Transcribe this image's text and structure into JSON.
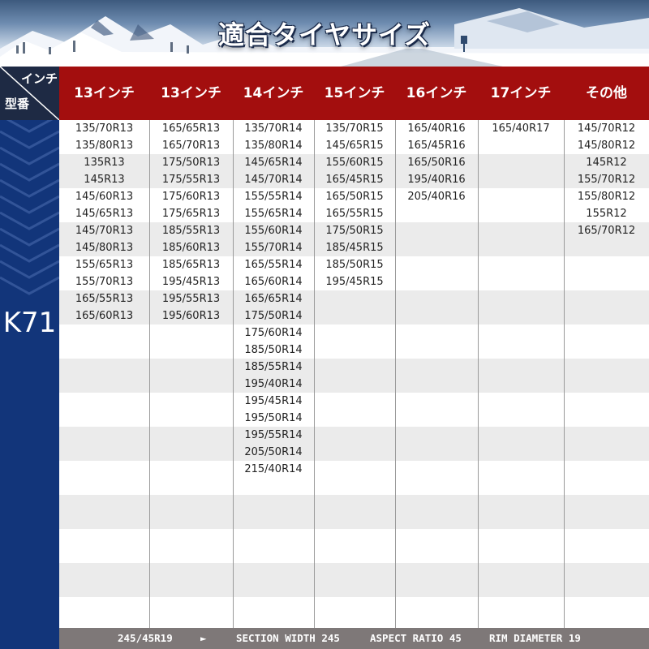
{
  "banner": {
    "title": "適合タイヤサイズ"
  },
  "corner": {
    "top_label": "インチ",
    "bottom_label": "型番"
  },
  "model": {
    "label": "K71"
  },
  "columns": [
    {
      "header": "13インチ",
      "sizes": [
        "135/70R13",
        "135/80R13",
        "135R13",
        "145R13",
        "145/60R13",
        "145/65R13",
        "145/70R13",
        "145/80R13",
        "155/65R13",
        "155/70R13",
        "165/55R13",
        "165/60R13"
      ]
    },
    {
      "header": "13インチ",
      "sizes": [
        "165/65R13",
        "165/70R13",
        "175/50R13",
        "175/55R13",
        "175/60R13",
        "175/65R13",
        "185/55R13",
        "185/60R13",
        "185/65R13",
        "195/45R13",
        "195/55R13",
        "195/60R13"
      ]
    },
    {
      "header": "14インチ",
      "sizes": [
        "135/70R14",
        "135/80R14",
        "145/65R14",
        "145/70R14",
        "155/55R14",
        "155/65R14",
        "155/60R14",
        "155/70R14",
        "165/55R14",
        "165/60R14",
        "165/65R14",
        "175/50R14",
        "175/60R14",
        "185/50R14",
        "185/55R14",
        "195/40R14",
        "195/45R14",
        "195/50R14",
        "195/55R14",
        "205/50R14",
        "215/40R14"
      ]
    },
    {
      "header": "15インチ",
      "sizes": [
        "135/70R15",
        "145/65R15",
        "155/60R15",
        "165/45R15",
        "165/50R15",
        "165/55R15",
        "175/50R15",
        "185/45R15",
        "185/50R15",
        "195/45R15"
      ]
    },
    {
      "header": "16インチ",
      "sizes": [
        "165/40R16",
        "165/45R16",
        "165/50R16",
        "195/40R16",
        "205/40R16"
      ]
    },
    {
      "header": "17インチ",
      "sizes": [
        "165/40R17"
      ]
    },
    {
      "header": "その他",
      "sizes": [
        "145/70R12",
        "145/80R12",
        "145R12",
        "155/70R12",
        "155/80R12",
        "155R12",
        "165/70R12"
      ]
    }
  ],
  "footer": {
    "example_size": "245/45R19",
    "arrow": "►",
    "section_width": "SECTION WIDTH 245",
    "aspect_ratio": "ASPECT RATIO 45",
    "rim_diameter": "RIM DIAMETER 19"
  },
  "colors": {
    "header_red": "#a30e0e",
    "left_navy": "#12357a",
    "footer_gray": "#7e7878",
    "stripe_gray": "#ebebeb"
  }
}
